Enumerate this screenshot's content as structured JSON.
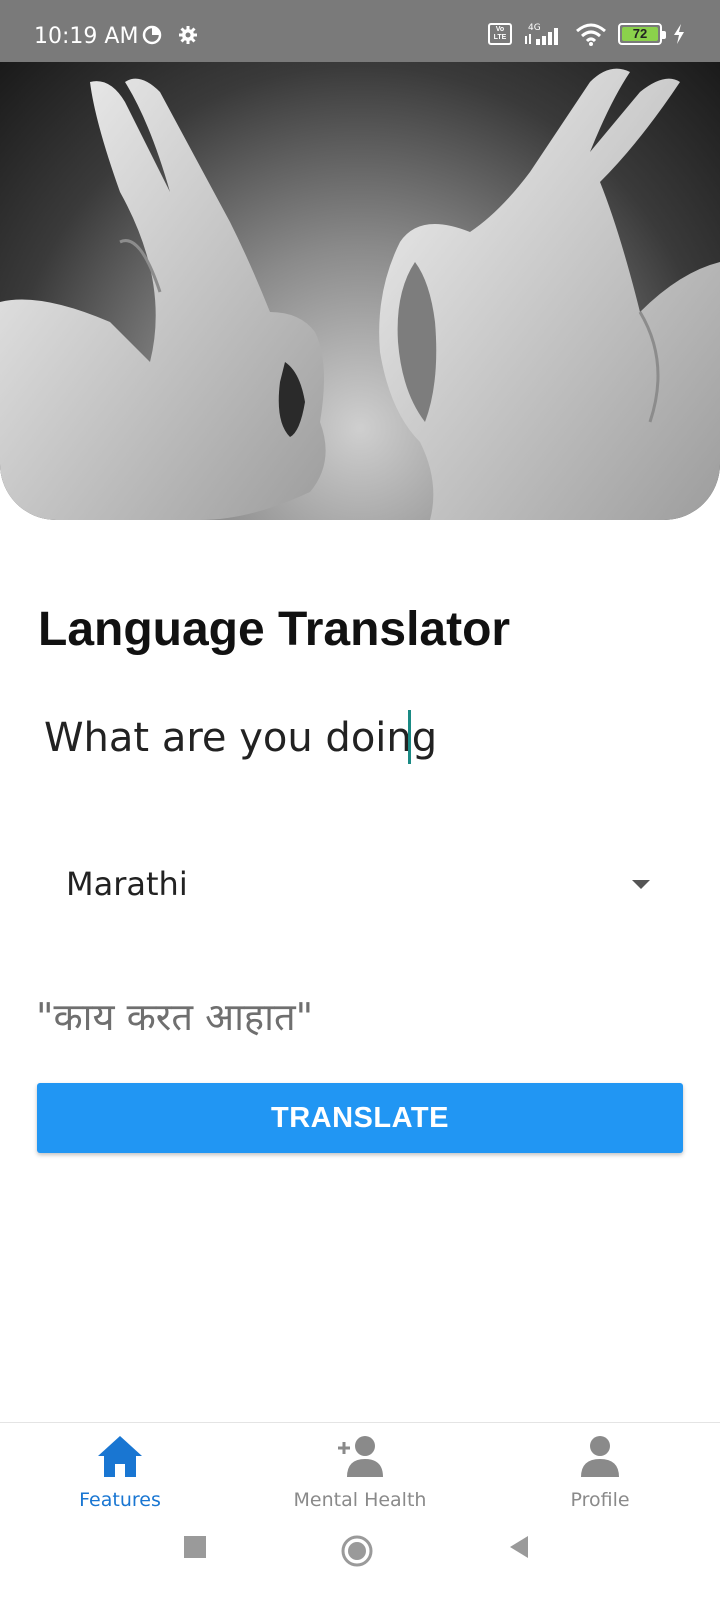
{
  "status_bar": {
    "time": "10:19 AM",
    "volte": "Vo LTE",
    "network": "4G",
    "battery": "72",
    "icons": [
      "data-saver-icon",
      "settings-gear-icon",
      "volte-icon",
      "signal-icon",
      "wifi-icon",
      "battery-icon",
      "charging-icon"
    ]
  },
  "hero": {
    "image": "hands-mouth-and-ear-illustration"
  },
  "main": {
    "title": "Language Translator",
    "input_value": "What are you doing",
    "selected_language": "Marathi",
    "result": "\"काय करत आहात\"",
    "translate_button": "TRANSLATE"
  },
  "bottom_nav": {
    "items": [
      {
        "label": "Features",
        "icon": "home-icon",
        "active": true
      },
      {
        "label": "Mental Health",
        "icon": "add-person-icon",
        "active": false
      },
      {
        "label": "Profile",
        "icon": "person-icon",
        "active": false
      }
    ]
  },
  "colors": {
    "accent": "#2196f3",
    "active_nav": "#1976d2",
    "inactive_nav": "#8a8a8a",
    "status_bar": "#7a7a7a"
  }
}
